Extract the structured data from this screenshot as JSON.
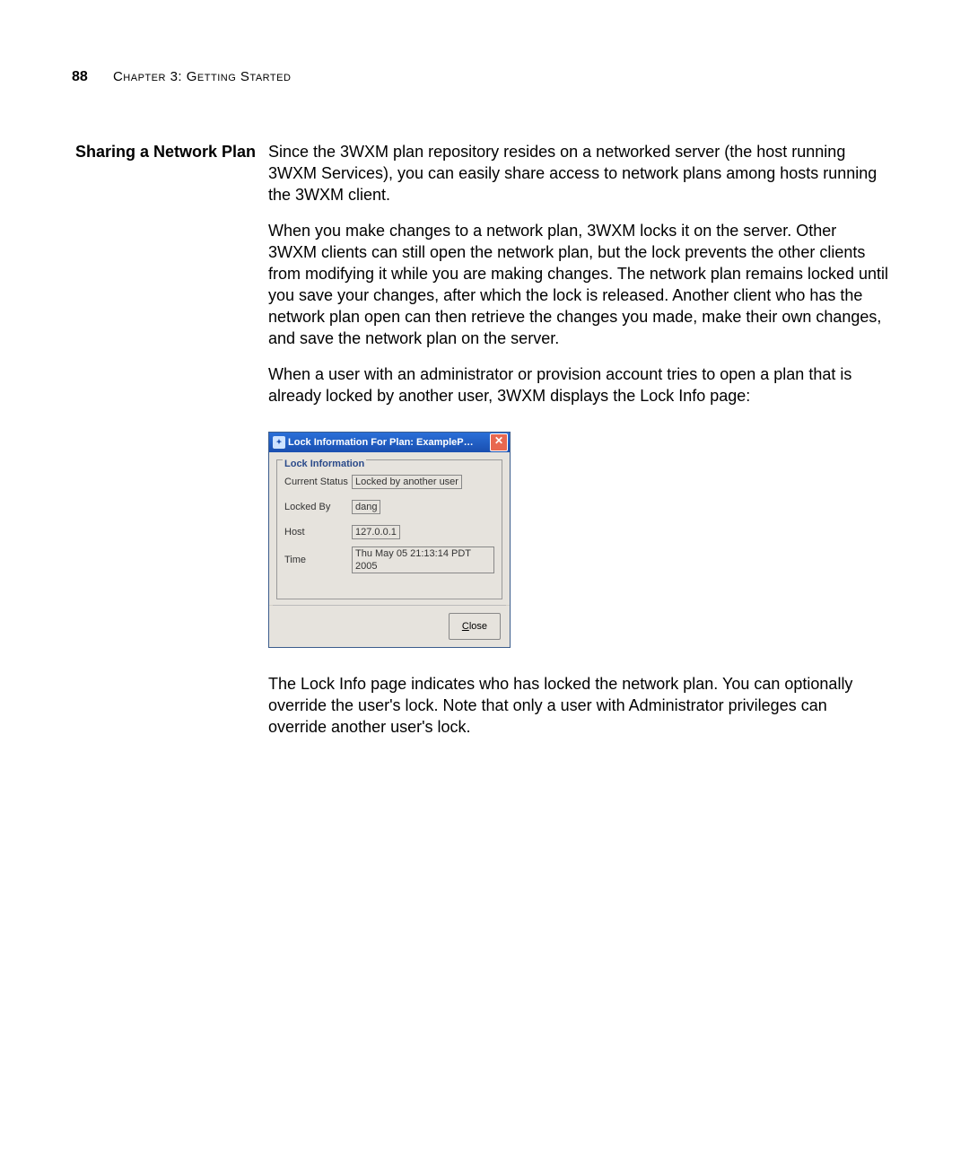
{
  "header": {
    "page_number": "88",
    "chapter_text": "Chapter 3: Getting Started"
  },
  "side_heading": "Sharing a Network Plan",
  "paragraphs": {
    "p1": "Since the 3WXM plan repository resides on a networked server (the host running 3WXM Services), you can easily share access to network plans among hosts running the 3WXM client.",
    "p2": "When you make changes to a network plan, 3WXM locks it on the server. Other 3WXM clients can still open the network plan, but the lock prevents the other clients from modifying it while you are making changes. The network plan remains locked until you save your changes, after which the lock is released. Another client who has the network plan open can then retrieve the changes you made, make their own changes, and save the network plan on the server.",
    "p3": "When a user with an administrator or provision account tries to open a plan that is already locked by another user, 3WXM displays the Lock Info page:",
    "p4": "The Lock Info page indicates who has locked the network plan. You can optionally override the user's lock. Note that only a user with Administrator privileges can override another user's lock."
  },
  "dialog": {
    "title": "Lock Information For Plan: ExampleP…",
    "groupbox_title": "Lock Information",
    "rows": {
      "status_label": "Current Status",
      "status_value": "Locked by another user",
      "locked_by_label": "Locked By",
      "locked_by_value": "dang",
      "host_label": "Host",
      "host_value": "127.0.0.1",
      "time_label": "Time",
      "time_value": "Thu May 05 21:13:14 PDT 2005"
    },
    "close_label": "Close"
  }
}
